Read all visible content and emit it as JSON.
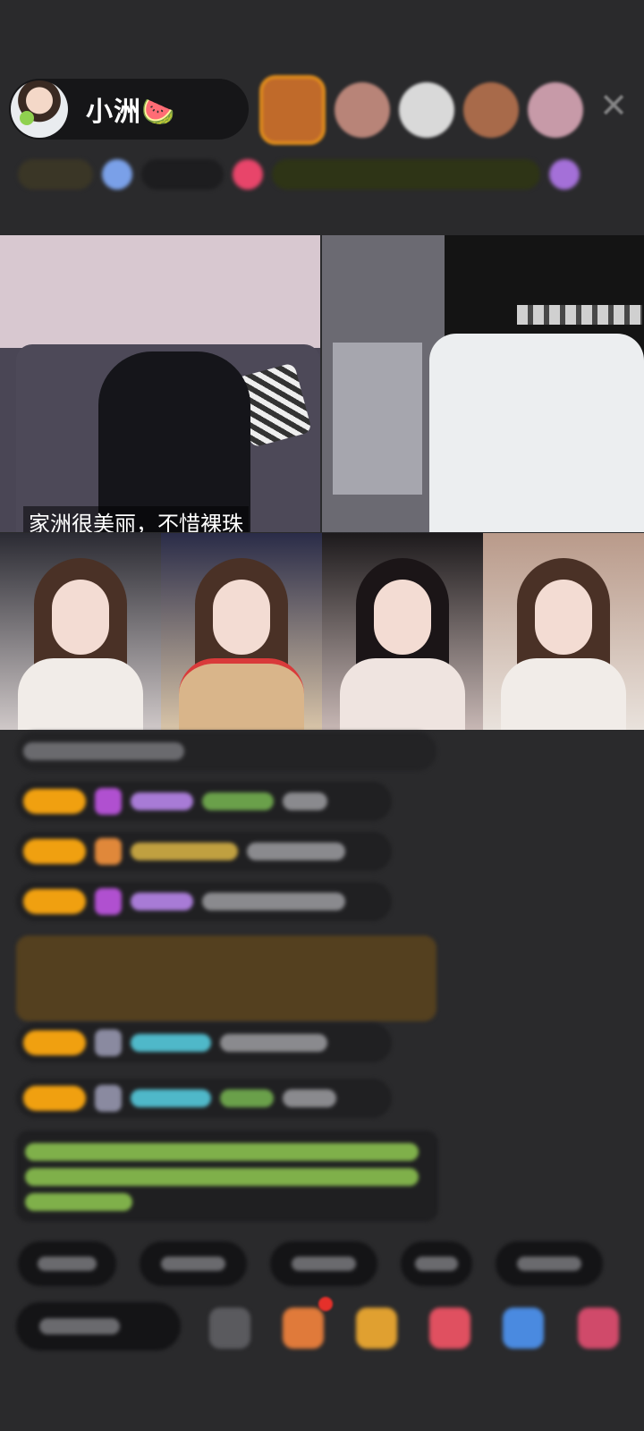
{
  "header": {
    "host_name": "小洲🍉",
    "close_symbol": "✕"
  },
  "viewers": [
    {
      "color": "#c06a2a"
    },
    {
      "color": "#b88478"
    },
    {
      "color": "#d9d9d9"
    },
    {
      "color": "#a86a4a"
    },
    {
      "color": "#c79aa8"
    }
  ],
  "video_grid": {
    "tile_1_caption": "家洲很美丽，不惜裸珠"
  },
  "chat": {
    "lines": 7
  },
  "colors": {
    "background": "#2a2a2c",
    "badge": "#f0a010",
    "gift_banner": "#54401f",
    "notice_text": "#7fb04a",
    "name_purple": "#a87bd6",
    "name_cyan": "#4fb8c9"
  }
}
